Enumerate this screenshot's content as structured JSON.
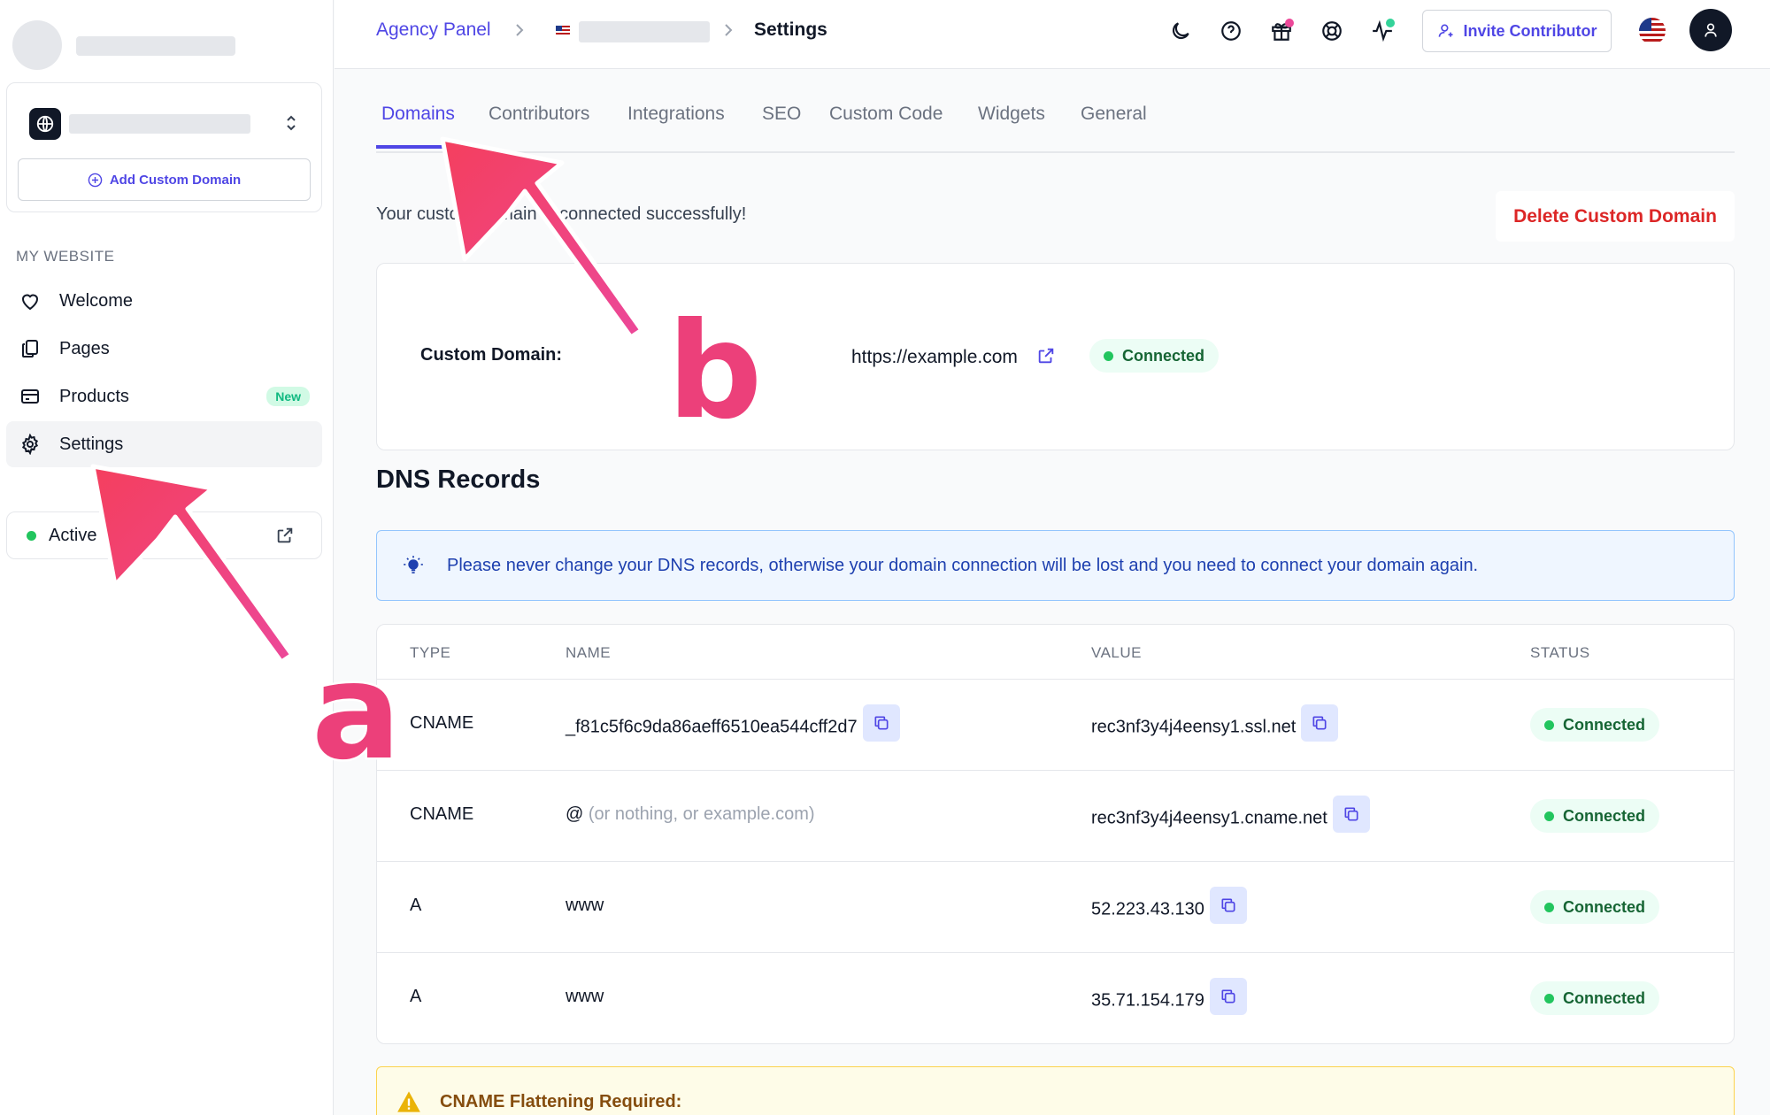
{
  "sidebar": {
    "add_domain_label": "Add Custom Domain",
    "section_label": "MY WEBSITE",
    "items": [
      {
        "label": "Welcome",
        "icon": "heart-icon"
      },
      {
        "label": "Pages",
        "icon": "pages-icon"
      },
      {
        "label": "Products",
        "icon": "card-icon",
        "badge": "New"
      },
      {
        "label": "Settings",
        "icon": "gear-icon",
        "active": true
      }
    ],
    "status_label": "Active"
  },
  "topbar": {
    "breadcrumb_root": "Agency Panel",
    "breadcrumb_current": "Settings",
    "invite_label": "Invite Contributor"
  },
  "tabs": [
    "Domains",
    "Contributors",
    "Integrations",
    "SEO",
    "Custom Code",
    "Widgets",
    "General"
  ],
  "active_tab": "Domains",
  "success_message": "Your custom domain is connected successfully!",
  "delete_label": "Delete Custom Domain",
  "domain": {
    "label": "Custom Domain:",
    "url": "https://example.com",
    "status": "Connected"
  },
  "dns": {
    "title": "DNS Records",
    "info": "Please never change your DNS records, otherwise your domain connection will be lost and you need to connect your domain again.",
    "headers": [
      "TYPE",
      "NAME",
      "VALUE",
      "STATUS"
    ],
    "rows": [
      {
        "type": "CNAME",
        "name": "_f81c5f6c9da86aeff6510ea544cff2d7",
        "value": "rec3nf3y4j4eensy1.ssl.net",
        "status": "Connected"
      },
      {
        "type": "CNAME",
        "name_prefix": "@",
        "name_hint": "(or nothing, or example.com)",
        "value": "rec3nf3y4j4eensy1.cname.net",
        "status": "Connected"
      },
      {
        "type": "A",
        "name": "www",
        "value": "52.223.43.130",
        "status": "Connected"
      },
      {
        "type": "A",
        "name": "www",
        "value": "35.71.154.179",
        "status": "Connected"
      }
    ]
  },
  "warning": "CNAME Flattening Required:",
  "annotations": {
    "a": "a",
    "b": "b"
  },
  "colors": {
    "accent": "#4f46e5",
    "danger": "#dc2626",
    "success": "#22c55e",
    "annotation": "#ec407a"
  }
}
